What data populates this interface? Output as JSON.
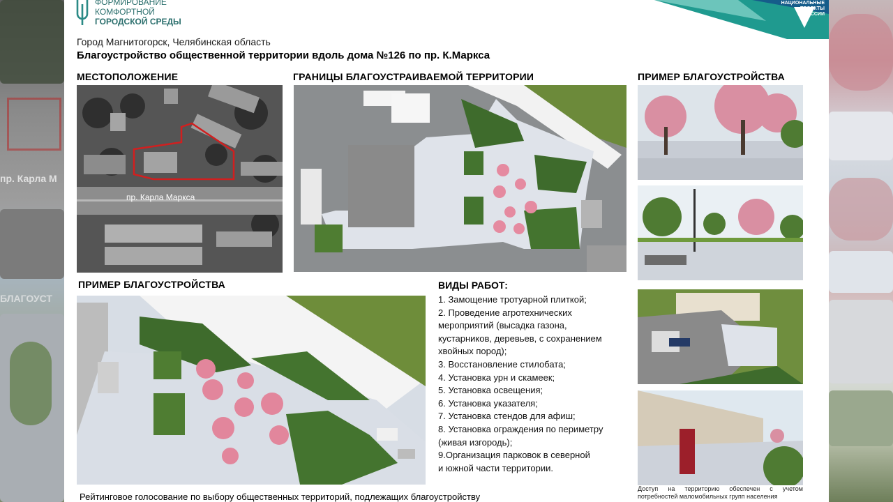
{
  "logo": {
    "line1": "ФОРМИРОВАНИЕ",
    "line2": "КОМФОРТНОЙ",
    "line3": "ГОРОДСКОЙ СРЕДЫ"
  },
  "corner_logo": {
    "line1": "НАЦИОНАЛЬНЫЕ",
    "line2": "ПРОЕКТЫ",
    "line3": "РОССИИ"
  },
  "city": "Город Магнитогорск, Челябинская область",
  "title": "Благоустройство общественной территории вдоль дома №126 по пр. К.Маркса",
  "headings": {
    "location": "МЕСТОПОЛОЖЕНИЕ",
    "boundaries": "ГРАНИЦЫ БЛАГОУСТРАИВАЕМОЙ ТЕРРИТОРИИ",
    "example_right": "ПРИМЕР БЛАГОУСТРОЙСТВА",
    "example_left": "ПРИМЕР БЛАГОУСТРОЙСТВА"
  },
  "map": {
    "street_label": "пр. Карла Маркса"
  },
  "side_left": {
    "ghost_text": "пр. Карла М",
    "ghost_text2": "БЛАГОУСТ"
  },
  "works": {
    "title": "ВИДЫ РАБОТ:",
    "lines": [
      "1. Замощение тротуарной плиткой;",
      "2. Проведение агротехнических",
      "мероприятий (высадка газона,",
      "кустарников, деревьев, с сохранением",
      "хвойных пород);",
      "3. Восстановление стилобата;",
      "4. Установка урн и скамеек;",
      "5. Установка освещения;",
      "6. Установка указателя;",
      "7. Установка стендов для афиш;",
      "8. Установка ограждения по периметру",
      "(живая изгородь);",
      "9.Организация парковок в северной",
      "и южной части территории."
    ]
  },
  "footer": "Рейтинговое голосование по выбору общественных территорий, подлежащих благоустройству",
  "note": "Доступ на территорию обеспечен с учетом потребностей маломобильных групп населения",
  "colors": {
    "brand_teal": "#2b8a86",
    "corner_teal": "#1f9a8f",
    "boundary_red": "#d11f1f",
    "paving": "#dfe3ea",
    "grass": "#5f8f3a",
    "blossom": "#e58aa0"
  }
}
